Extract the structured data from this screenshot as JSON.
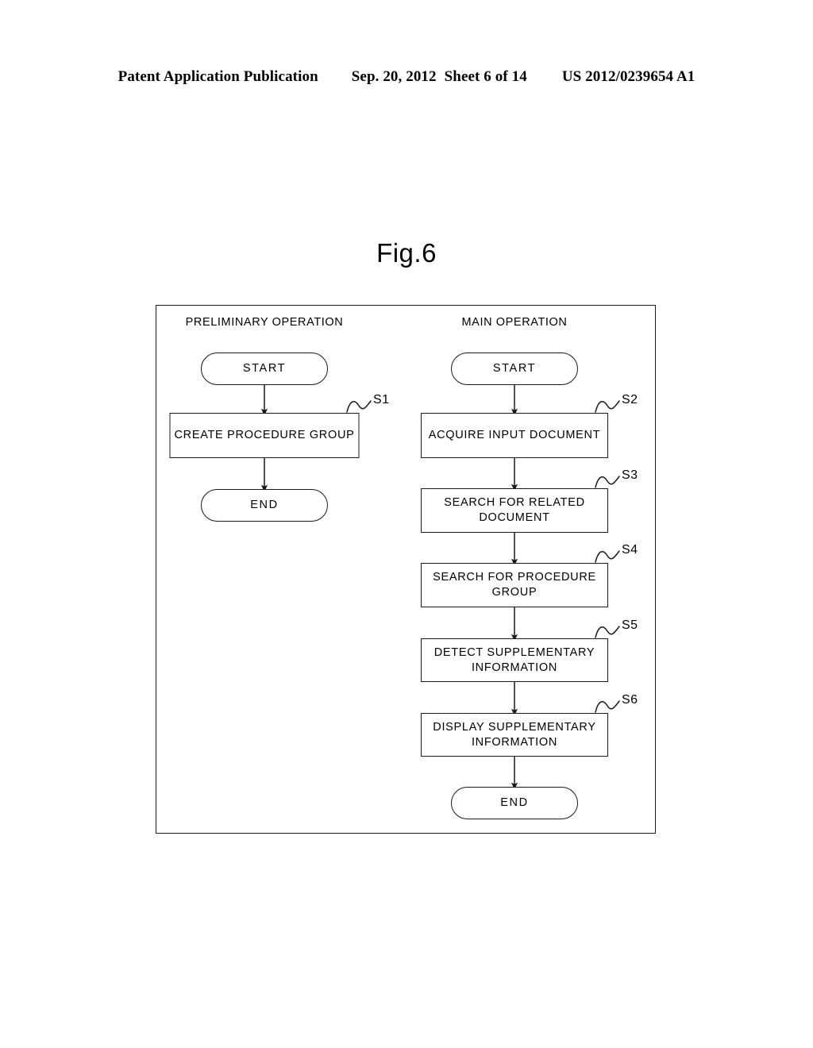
{
  "header": {
    "publication": "Patent Application Publication",
    "date": "Sep. 20, 2012",
    "sheet": "Sheet 6 of 14",
    "number": "US 2012/0239654 A1"
  },
  "figure": {
    "title": "Fig.6",
    "columns": [
      {
        "id": "preliminary",
        "heading": "PRELIMINARY OPERATION"
      },
      {
        "id": "main",
        "heading": "MAIN OPERATION"
      }
    ]
  },
  "flowchart": {
    "preliminary": {
      "start": "START",
      "steps": [
        {
          "label": "S1",
          "text": "CREATE PROCEDURE GROUP"
        }
      ],
      "end": "END"
    },
    "main": {
      "start": "START",
      "steps": [
        {
          "label": "S2",
          "text": "ACQUIRE INPUT DOCUMENT"
        },
        {
          "label": "S3",
          "text": "SEARCH FOR RELATED DOCUMENT"
        },
        {
          "label": "S4",
          "text": "SEARCH FOR PROCEDURE GROUP"
        },
        {
          "label": "S5",
          "text": "DETECT SUPPLEMENTARY INFORMATION"
        },
        {
          "label": "S6",
          "text": "DISPLAY SUPPLEMENTARY INFORMATION"
        }
      ],
      "end": "END"
    }
  },
  "colors": {
    "ink": "#1a1a1a",
    "background": "#ffffff"
  }
}
